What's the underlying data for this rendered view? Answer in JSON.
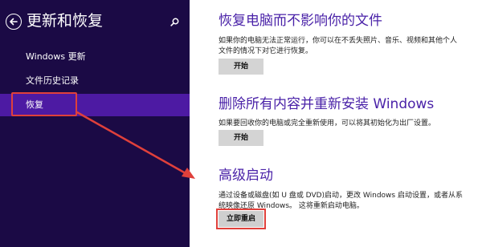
{
  "sidebar": {
    "title": "更新和恢复",
    "items": [
      {
        "label": "Windows 更新"
      },
      {
        "label": "文件历史记录"
      },
      {
        "label": "恢复"
      }
    ]
  },
  "sections": [
    {
      "title": "恢复电脑而不影响你的文件",
      "desc": "如果你的电脑无法正常运行，你可以在不丢失照片、音乐、视频和其他个人文件的情况下对它进行恢复。",
      "button": "开始"
    },
    {
      "title": "删除所有内容并重新安装 Windows",
      "desc": "如果要回收你的电脑或完全重新使用，可以将其初始化为出厂设置。",
      "button": "开始"
    },
    {
      "title": "高级启动",
      "desc": "通过设备或磁盘(如 U 盘或 DVD)启动，更改 Windows 启动设置，或者从系统映像还原 Windows。 这将重新启动电脑。",
      "button": "立即重启"
    }
  ],
  "colors": {
    "sidebar_bg": "#1b0a45",
    "selected_bg": "#4d1aa3",
    "title_color": "#4a22a8",
    "annotation": "#e0403b"
  },
  "icons": {
    "back": "back-arrow-circle-icon",
    "search": "search-icon"
  }
}
